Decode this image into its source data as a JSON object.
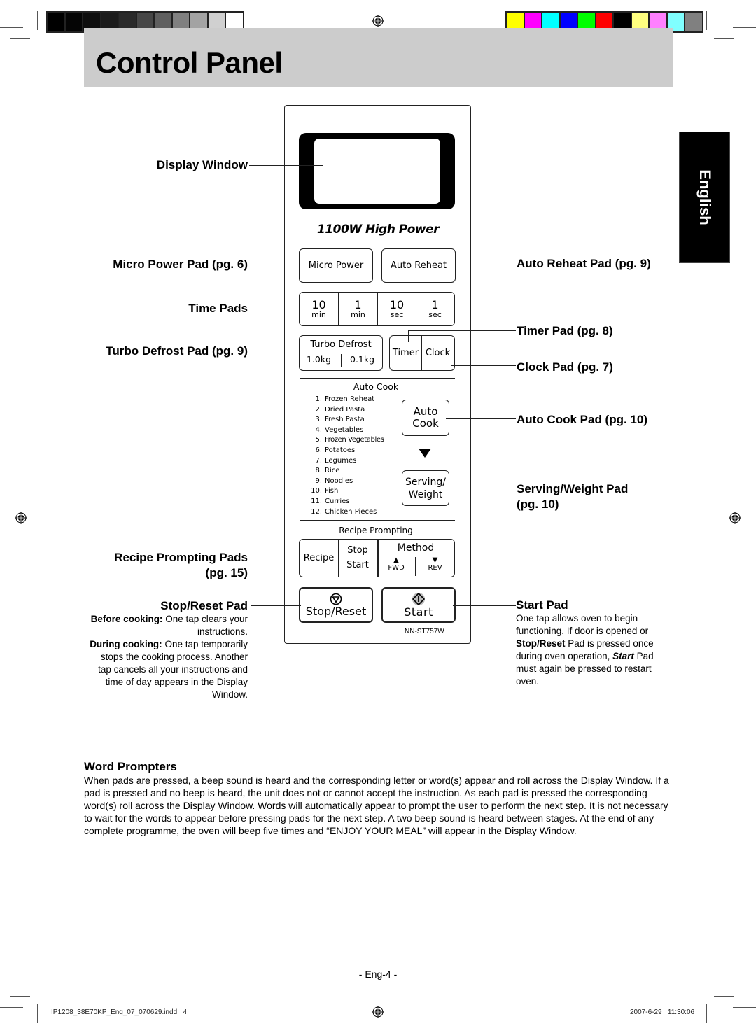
{
  "print_marks": {
    "gray_swatches": [
      "#000000",
      "#050505",
      "#0e0e0e",
      "#1c1c1c",
      "#2a2a2a",
      "#474747",
      "#5f5f5f",
      "#808080",
      "#a3a3a3",
      "#d0d0d0",
      "#ffffff"
    ],
    "color_swatches": [
      "#ffff00",
      "#ff00ff",
      "#00ffff",
      "#0000ff",
      "#00ff00",
      "#ff0000",
      "#000000",
      "#ffff80",
      "#ff80ff",
      "#80ffff",
      "#808080"
    ]
  },
  "header": {
    "title": "Control Panel",
    "band_color": "#cccccc"
  },
  "language_tab": "English",
  "panel": {
    "power_label": "1100W  High Power",
    "pads": {
      "micro_power": "Micro Power",
      "auto_reheat": "Auto Reheat",
      "time_pads": [
        {
          "value": "10",
          "unit": "min"
        },
        {
          "value": "1",
          "unit": "min"
        },
        {
          "value": "10",
          "unit": "sec"
        },
        {
          "value": "1",
          "unit": "sec"
        }
      ],
      "turbo_defrost": {
        "title": "Turbo Defrost",
        "left": "1.0kg",
        "right": "0.1kg"
      },
      "timer": "Timer",
      "clock": "Clock",
      "auto_cook_line1": "Auto",
      "auto_cook_line2": "Cook",
      "serving_line1": "Serving/",
      "serving_line2": "Weight",
      "recipe": "Recipe",
      "stop": "Stop",
      "start_small": "Start",
      "method": "Method",
      "fwd": "FWD",
      "rev": "REV",
      "stop_reset": "Stop/Reset",
      "start": "Start"
    },
    "auto_cook_title": "Auto Cook",
    "auto_cook_list": [
      {
        "num": "1.",
        "name": "Frozen Reheat"
      },
      {
        "num": "2.",
        "name": "Dried Pasta"
      },
      {
        "num": "3.",
        "name": "Fresh Pasta"
      },
      {
        "num": "4.",
        "name": "Vegetables"
      },
      {
        "num": "5.",
        "name": "Frozen Vegetables"
      },
      {
        "num": "6.",
        "name": "Potatoes"
      },
      {
        "num": "7.",
        "name": "Legumes"
      },
      {
        "num": "8.",
        "name": "Rice"
      },
      {
        "num": "9.",
        "name": "Noodles"
      },
      {
        "num": "10.",
        "name": "Fish"
      },
      {
        "num": "11.",
        "name": "Curries"
      },
      {
        "num": "12.",
        "name": "Chicken Pieces"
      }
    ],
    "recipe_prompting_title": "Recipe Prompting",
    "model": "NN-ST757W"
  },
  "callouts_left": {
    "display_window": "Display Window",
    "micro_power": "Micro Power Pad (pg. 6)",
    "time_pads": "Time Pads",
    "turbo_defrost": "Turbo Defrost Pad (pg. 9)",
    "recipe_prompting_1": "Recipe Prompting Pads",
    "recipe_prompting_2": "(pg. 15)",
    "stop_reset": "Stop/Reset Pad",
    "stop_reset_desc": {
      "before_bold": "Before cooking:",
      "before_text": " One tap clears your instructions.",
      "during_bold": "During cooking:",
      "during_text": " One tap temporarily stops the cooking process. Another tap cancels all your instructions and time of day appears in the Display Window."
    }
  },
  "callouts_right": {
    "auto_reheat": "Auto Reheat Pad (pg. 9)",
    "timer": "Timer Pad (pg. 8)",
    "clock": "Clock Pad (pg. 7)",
    "auto_cook": "Auto Cook Pad (pg. 10)",
    "serving_1": "Serving/Weight Pad",
    "serving_2": "(pg. 10)",
    "start": "Start Pad",
    "start_desc": {
      "t1": "One tap allows oven to begin functioning. If door is opened or ",
      "b1": "Stop/Reset",
      "t2": " Pad is pressed once during oven operation, ",
      "bi": "Start",
      "t3": " Pad must again be pressed to restart oven."
    }
  },
  "word_prompters": {
    "title": "Word Prompters",
    "body": "When pads are pressed, a beep sound is heard and the corresponding letter or word(s) appear and roll across the Display Window. If a pad is pressed and no beep is heard, the unit does not or cannot accept the instruction. As each pad is pressed the corresponding word(s) roll across the Display Window. Words will automatically appear to prompt the user to perform the next step. It is not necessary to wait for the words to appear before pressing pads for the next step. A two beep sound is heard between stages. At the end of any complete programme, the oven will beep five times and “ENJOY YOUR MEAL” will appear in the Display Window."
  },
  "footer": {
    "page_number": "- Eng-4 -",
    "file_slug": "IP1208_38E70KP_Eng_07_070629.indd   4",
    "timestamp": "2007-6-29   11:30:06"
  }
}
